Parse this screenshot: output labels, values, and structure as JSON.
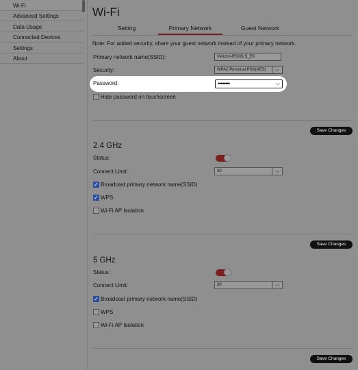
{
  "sidebar": {
    "items": [
      {
        "label": "Wi-Fi"
      },
      {
        "label": "Advanced Settings"
      },
      {
        "label": "Data Usage"
      },
      {
        "label": "Connected Devices"
      },
      {
        "label": "Settings"
      },
      {
        "label": "About"
      }
    ]
  },
  "page": {
    "title": "Wi-Fi",
    "tabs": [
      {
        "label": "Setting"
      },
      {
        "label": "Primary Network"
      },
      {
        "label": "Guest Network"
      }
    ],
    "note": "Note: For added security, share your guest network instead of your primary network."
  },
  "primary": {
    "ssid_label": "Primary network name(SSID):",
    "ssid_value": "Verizon-RS00LS_E6",
    "security_label": "Security:",
    "security_value": "WPA2 Personal PSK(AES)",
    "password_label": "Password:",
    "password_value": "••••••••",
    "hide_password_label": "Hide password on touchscreen",
    "save_label": "Save Changes"
  },
  "band24": {
    "title": "2.4 GHz",
    "status_label": "Status:",
    "connect_limit_label": "Connect Limit:",
    "connect_limit_value": "30",
    "broadcast_label": "Broadcast primary network name(SSID)",
    "wps_label": "WPS",
    "isolation_label": "Wi-Fi AP Isolation",
    "save_label": "Save Changes"
  },
  "band5": {
    "title": "5 GHz",
    "status_label": "Status:",
    "connect_limit_label": "Connect Limit:",
    "connect_limit_value": "30",
    "broadcast_label": "Broadcast primary network name(SSID)",
    "wps_label": "WPS",
    "isolation_label": "Wi-Fi AP Isolation",
    "save_label": "Save Changes"
  },
  "icons": {
    "check": "✓",
    "chevron": "⌵"
  },
  "colors": {
    "accent": "#7a1c1c",
    "checkbox": "#2f4fa0",
    "button": "#111111"
  }
}
